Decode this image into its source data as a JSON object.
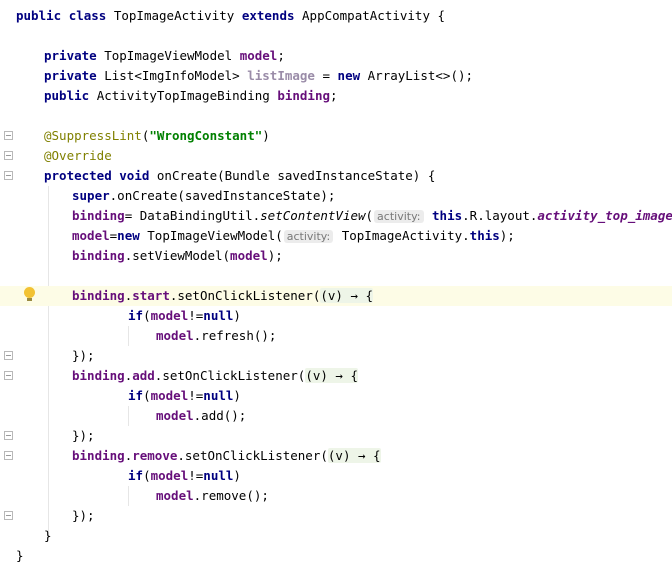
{
  "code": {
    "class_decl": {
      "kw1": "public",
      "kw2": "class",
      "name": "TopImageActivity",
      "kw3": "extends",
      "parent": "AppCompatActivity",
      "brace": "{"
    },
    "f1": {
      "kw": "private",
      "type": "TopImageViewModel",
      "name": "model",
      "semi": ";"
    },
    "f2": {
      "kw": "private",
      "type": "List<ImgInfoModel>",
      "name": "listImage",
      "eq": "=",
      "kw_new": "new",
      "rest": "ArrayList<>();"
    },
    "f3": {
      "kw": "public",
      "type": "ActivityTopImageBinding",
      "name": "binding",
      "semi": ";"
    },
    "a1": {
      "ann": "@SuppressLint",
      "open": "(",
      "str": "\"WrongConstant\"",
      "close": ")"
    },
    "a2": {
      "ann": "@Override"
    },
    "m1": {
      "kw1": "protected",
      "kw2": "void",
      "sig": "onCreate(Bundle savedInstanceState) {"
    },
    "s1": {
      "kw": "super",
      "rest": ".onCreate(savedInstanceState);"
    },
    "s2": {
      "field": "binding",
      "eq": "= DataBindingUtil.",
      "method": "setContentView",
      "open": "(",
      "hint": "activity:",
      "kw_this": "this",
      "mid": ".R.layout.",
      "res": "activity_top_image",
      "end": ");"
    },
    "s3": {
      "field": "model",
      "eq": "=",
      "kw_new": "new",
      "ctor": "TopImageViewModel(",
      "hint": "activity:",
      "ref": "TopImageActivity.",
      "kw_this": "this",
      "end": ");"
    },
    "s4": {
      "field": "binding",
      "dot": ".setViewModel(",
      "arg": "model",
      "end": ");"
    },
    "l1": {
      "field": "binding",
      "dot": ".",
      "sub": "start",
      "call": ".setOnClickListener(",
      "lambda": "(v) → {"
    },
    "if1": {
      "kw": "if",
      "open": "(",
      "field": "model",
      "op": "!=",
      "kw_null": "null",
      "close": ")"
    },
    "c1": {
      "field": "model",
      "call": ".refresh();"
    },
    "e1": {
      "text": "});"
    },
    "l2": {
      "field": "binding",
      "dot": ".",
      "sub": "add",
      "call": ".setOnClickListener(",
      "lambda": "(v) → {"
    },
    "if2": {
      "kw": "if",
      "open": "(",
      "field": "model",
      "op": "!=",
      "kw_null": "null",
      "close": ")"
    },
    "c2": {
      "field": "model",
      "call": ".add();"
    },
    "e2": {
      "text": "});"
    },
    "l3": {
      "field": "binding",
      "dot": ".",
      "sub": "remove",
      "call": ".setOnClickListener(",
      "lambda": "(v) → {"
    },
    "if3": {
      "kw": "if",
      "open": "(",
      "field": "model",
      "op": "!=",
      "kw_null": "null",
      "close": ")"
    },
    "c3": {
      "field": "model",
      "call": ".remove();"
    },
    "e3": {
      "text": "});"
    },
    "close_method": "}",
    "close_class": "}"
  },
  "icons": {
    "gutter_fold": "fold-marker-icon",
    "intention": "lightbulb-icon"
  },
  "colors": {
    "keyword": "#000080",
    "field": "#660e7a",
    "annotation": "#808000",
    "string": "#008000",
    "highlight": "#fdfce6"
  }
}
